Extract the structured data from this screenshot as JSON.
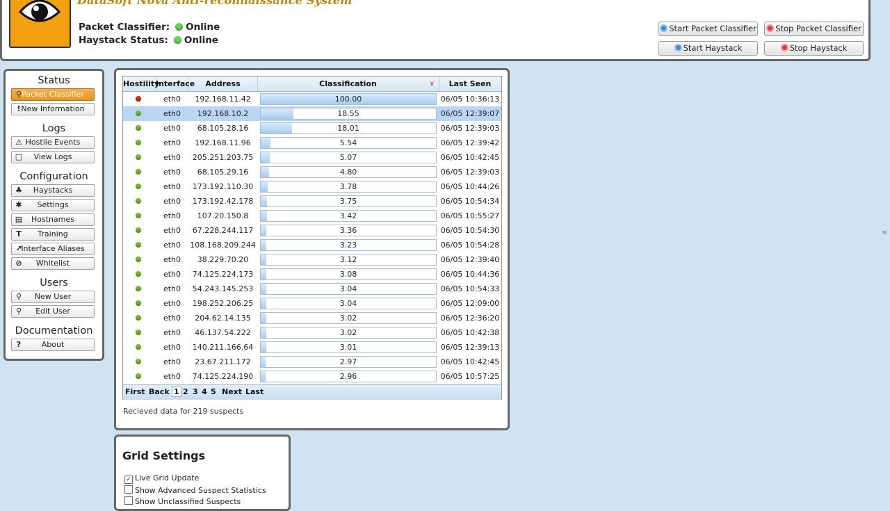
{
  "app": {
    "title": "DataSoft Nova Anti-reconnaissance System",
    "packet_classifier_label": "Packet Classifier:",
    "packet_classifier_status": "Online",
    "haystack_label": "Haystack  Status:",
    "haystack_status": "Online"
  },
  "controls": {
    "start_packet_classifier": "Start Packet Classifier",
    "stop_packet_classifier": "Stop Packet Classifier",
    "start_haystack": "Start Haystack",
    "stop_haystack": "Stop Haystack"
  },
  "sidebar": {
    "status_title": "Status",
    "packet_classifier": "Packet Classifier",
    "new_information": "New Information",
    "logs_title": "Logs",
    "hostile_events": "Hostile Events",
    "view_logs": "View Logs",
    "configuration_title": "Configuration",
    "haystacks": "Haystacks",
    "settings": "Settings",
    "hostnames": "Hostnames",
    "training": "Training",
    "interface_aliases": "Interface Aliases",
    "whitelist": "Whitelist",
    "users_title": "Users",
    "new_user": "New User",
    "edit_user": "Edit User",
    "documentation_title": "Documentation",
    "about": "About"
  },
  "grid": {
    "columns": [
      "Hostility",
      "Interface",
      "Address",
      "Classification",
      "Last Seen"
    ],
    "sort_indicator": "∨",
    "rows": [
      {
        "hostility": "hostile",
        "interface": "eth0",
        "address": "192.168.11.42",
        "classification": "100.00",
        "classification_value": 100.0,
        "last_seen": "06/05 10:36:13"
      },
      {
        "hostility": "benign",
        "interface": "eth0",
        "address": "192.168.10.2",
        "classification": "18.55",
        "classification_value": 18.55,
        "last_seen": "06/05 12:39:07",
        "selected": true
      },
      {
        "hostility": "benign",
        "interface": "eth0",
        "address": "68.105.28.16",
        "classification": "18.01",
        "classification_value": 18.01,
        "last_seen": "06/05 12:39:03"
      },
      {
        "hostility": "benign",
        "interface": "eth0",
        "address": "192.168.11.96",
        "classification": "5.54",
        "classification_value": 5.54,
        "last_seen": "06/05 12:39:42"
      },
      {
        "hostility": "benign",
        "interface": "eth0",
        "address": "205.251.203.75",
        "classification": "5.07",
        "classification_value": 5.07,
        "last_seen": "06/05 10:42:45"
      },
      {
        "hostility": "benign",
        "interface": "eth0",
        "address": "68.105.29.16",
        "classification": "4.80",
        "classification_value": 4.8,
        "last_seen": "06/05 12:39:03"
      },
      {
        "hostility": "benign",
        "interface": "eth0",
        "address": "173.192.110.30",
        "classification": "3.78",
        "classification_value": 3.78,
        "last_seen": "06/05 10:44:26"
      },
      {
        "hostility": "benign",
        "interface": "eth0",
        "address": "173.192.42.178",
        "classification": "3.75",
        "classification_value": 3.75,
        "last_seen": "06/05 10:54:34"
      },
      {
        "hostility": "benign",
        "interface": "eth0",
        "address": "107.20.150.8",
        "classification": "3.42",
        "classification_value": 3.42,
        "last_seen": "06/05 10:55:27"
      },
      {
        "hostility": "benign",
        "interface": "eth0",
        "address": "67.228.244.117",
        "classification": "3.36",
        "classification_value": 3.36,
        "last_seen": "06/05 10:54:30"
      },
      {
        "hostility": "benign",
        "interface": "eth0",
        "address": "108.168.209.244",
        "classification": "3.23",
        "classification_value": 3.23,
        "last_seen": "06/05 10:54:28"
      },
      {
        "hostility": "benign",
        "interface": "eth0",
        "address": "38.229.70.20",
        "classification": "3.12",
        "classification_value": 3.12,
        "last_seen": "06/05 12:39:40"
      },
      {
        "hostility": "benign",
        "interface": "eth0",
        "address": "74.125.224.173",
        "classification": "3.08",
        "classification_value": 3.08,
        "last_seen": "06/05 10:44:36"
      },
      {
        "hostility": "benign",
        "interface": "eth0",
        "address": "54.243.145.253",
        "classification": "3.04",
        "classification_value": 3.04,
        "last_seen": "06/05 10:54:33"
      },
      {
        "hostility": "benign",
        "interface": "eth0",
        "address": "198.252.206.25",
        "classification": "3.04",
        "classification_value": 3.04,
        "last_seen": "06/05 12:09:00"
      },
      {
        "hostility": "benign",
        "interface": "eth0",
        "address": "204.62.14.135",
        "classification": "3.02",
        "classification_value": 3.02,
        "last_seen": "06/05 12:36:20"
      },
      {
        "hostility": "benign",
        "interface": "eth0",
        "address": "46.137.54.222",
        "classification": "3.02",
        "classification_value": 3.02,
        "last_seen": "06/05 10:42:38"
      },
      {
        "hostility": "benign",
        "interface": "eth0",
        "address": "140.211.166.64",
        "classification": "3.01",
        "classification_value": 3.01,
        "last_seen": "06/05 12:39:13"
      },
      {
        "hostility": "benign",
        "interface": "eth0",
        "address": "23.67.211.172",
        "classification": "2.97",
        "classification_value": 2.97,
        "last_seen": "06/05 10:42:45"
      },
      {
        "hostility": "benign",
        "interface": "eth0",
        "address": "74.125.224.190",
        "classification": "2.96",
        "classification_value": 2.96,
        "last_seen": "06/05 10:57:25"
      }
    ],
    "pager": {
      "first": "First",
      "back": "Back",
      "pages": [
        "1",
        "2",
        "3",
        "4",
        "5"
      ],
      "current_page": "1",
      "next": "Next",
      "last": "Last"
    },
    "status": "Recieved data for 219 suspects"
  },
  "grid_settings": {
    "title": "Grid Settings",
    "options": [
      {
        "label": "Live Grid Update",
        "checked": true
      },
      {
        "label": "Show Advanced Suspect Statistics",
        "checked": false
      },
      {
        "label": "Show Unclassified Suspects",
        "checked": false
      }
    ]
  },
  "colors": {
    "background": "#cfe3f3",
    "accent_orange": "#e89620",
    "online_green": "#6ecf62",
    "hostile_red": "#cc3a1a"
  }
}
